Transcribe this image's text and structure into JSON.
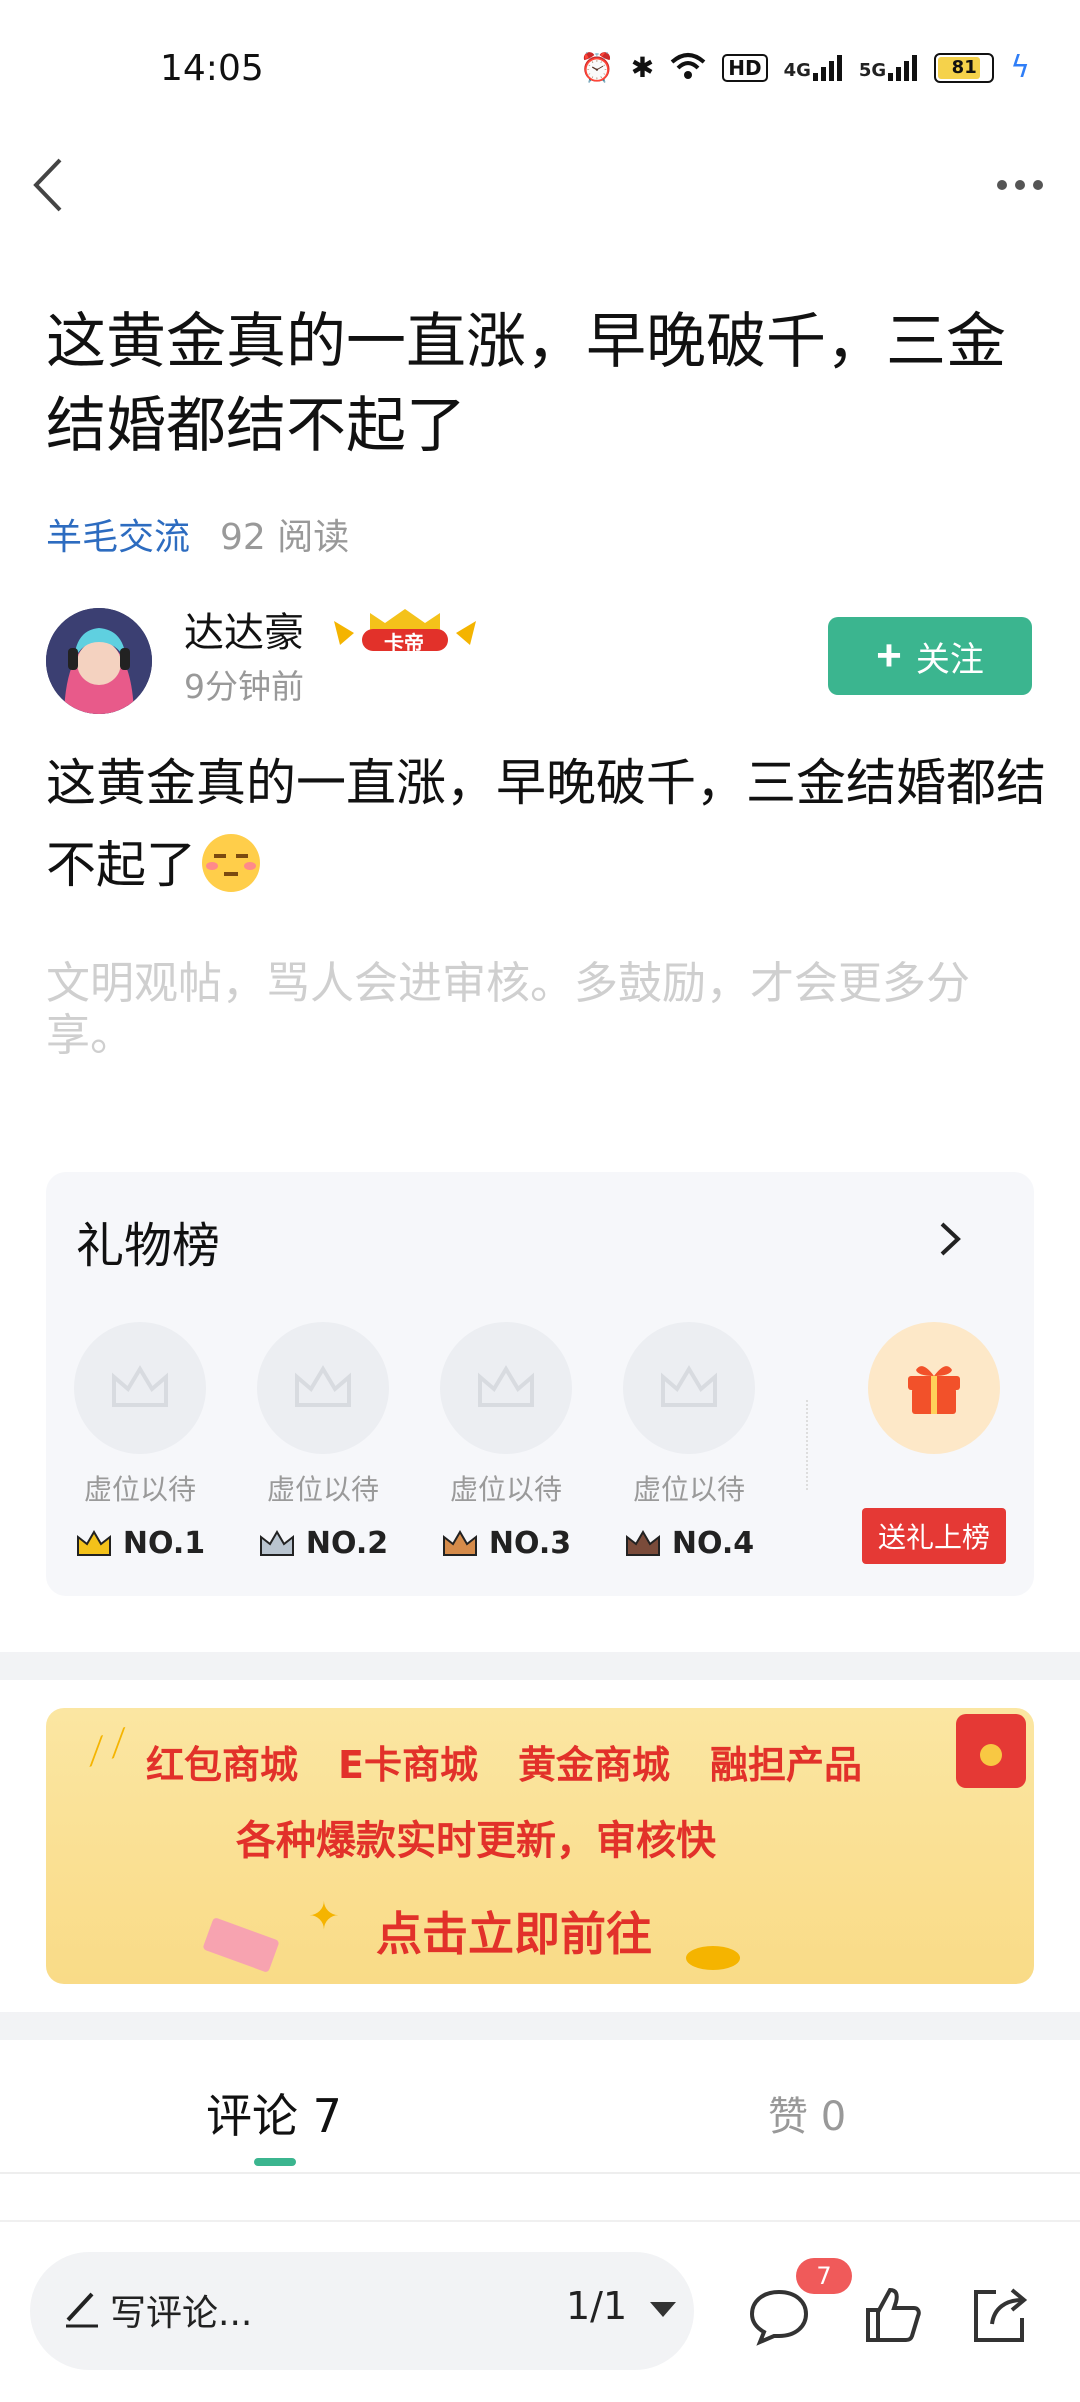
{
  "status_bar": {
    "time": "14:05",
    "network_label": "HD",
    "signal_1": "4G",
    "signal_2": "5G",
    "battery": "81"
  },
  "nav": {
    "back_icon": "chevron-left-icon",
    "more_icon": "more-dots-icon"
  },
  "post": {
    "title": "这黄金真的一直涨，早晚破千，三金结婚都结不起了",
    "circle": "羊毛交流",
    "reads": "92 阅读",
    "author": "达达豪",
    "badge": "卡帝",
    "time": "9分钟前",
    "follow_label": "关注",
    "body": "这黄金真的一直涨，早晚破千，三金结婚都结不起了",
    "hint": "文明观帖，骂人会进审核。多鼓励，才会更多分享。"
  },
  "gift_board": {
    "title": "礼物榜",
    "slots": [
      {
        "label": "虚位以待",
        "rank": "NO.1",
        "crown_color": "#f4c21a"
      },
      {
        "label": "虚位以待",
        "rank": "NO.2",
        "crown_color": "#b9c4cf"
      },
      {
        "label": "虚位以待",
        "rank": "NO.3",
        "crown_color": "#d58b4a"
      },
      {
        "label": "虚位以待",
        "rank": "NO.4",
        "crown_color": "#7a4b3a"
      }
    ],
    "send_label": "送礼上榜"
  },
  "banner": {
    "items": [
      "红包商城",
      "E卡商城",
      "黄金商城",
      "融担产品"
    ],
    "line2": "各种爆款实时更新，审核快",
    "cta": "点击立即前往"
  },
  "tabs": {
    "comments": "评论 7",
    "likes": "赞 0"
  },
  "bottom_bar": {
    "placeholder": "写评论...",
    "pager": "1/1",
    "comment_count": "7"
  },
  "colors": {
    "accent": "#3bb58f",
    "link": "#2d6cc0",
    "gift_red": "#e53935"
  }
}
